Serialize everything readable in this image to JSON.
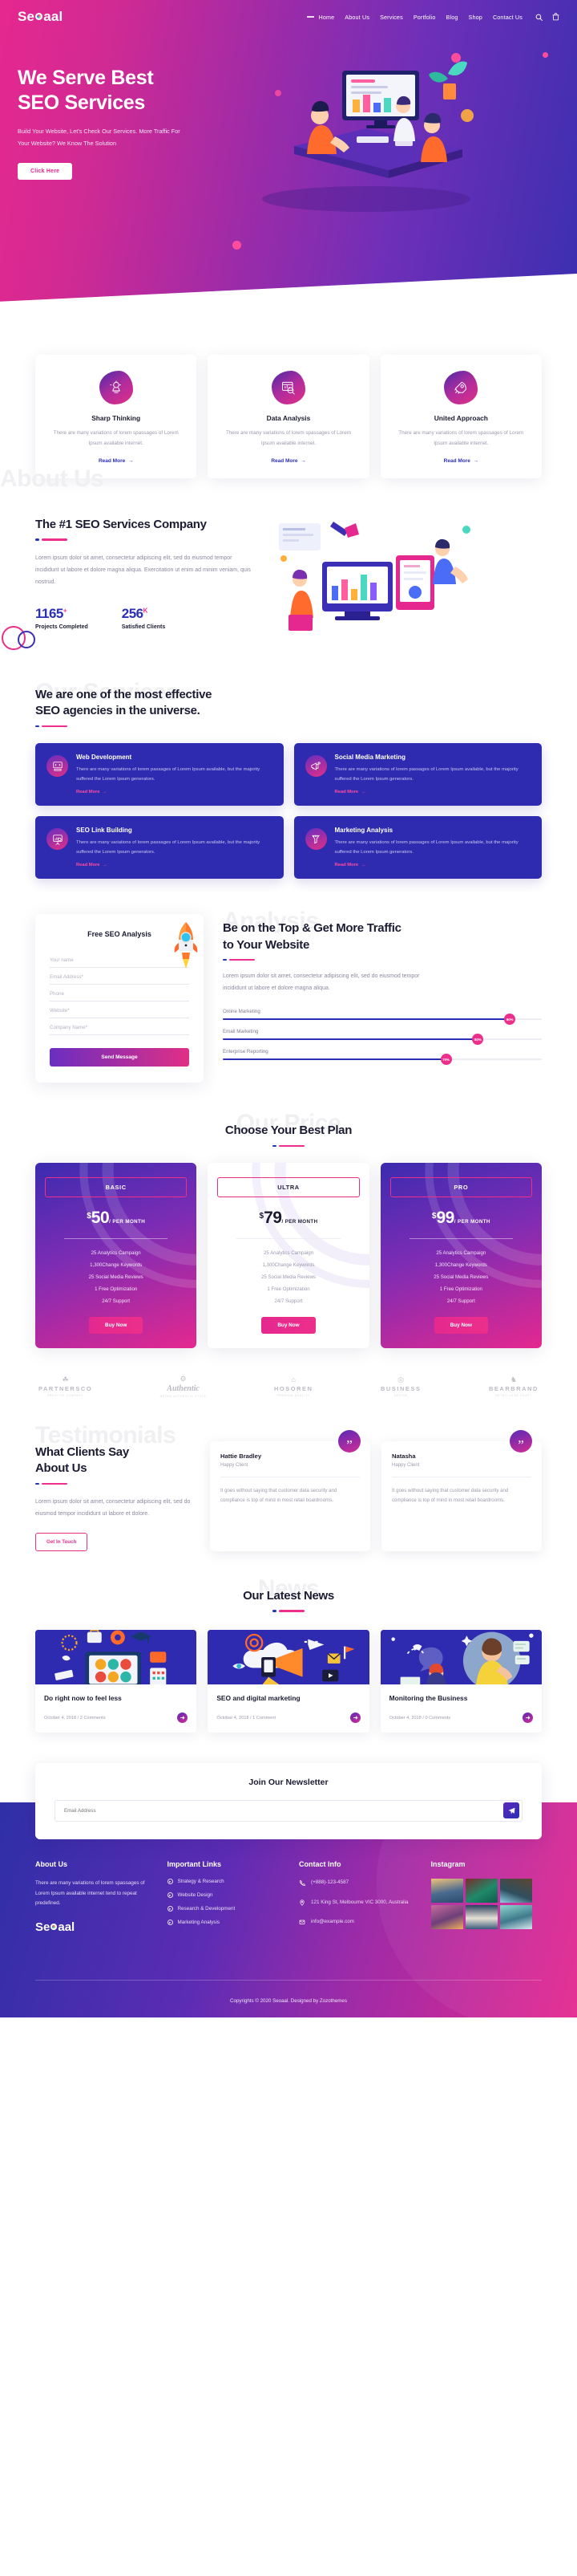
{
  "brand": {
    "name_part1": "Se",
    "name_part2": "aal",
    "logo_dot": "rainbow-dot"
  },
  "colors": {
    "pink": "#ec2f8a",
    "indigo": "#2b2fb5",
    "purple": "#6a2ec0",
    "card_blue": "#2e2bb0"
  },
  "nav": {
    "items": [
      {
        "label": "Home",
        "active": true
      },
      {
        "label": "About Us",
        "active": false
      },
      {
        "label": "Services",
        "active": false
      },
      {
        "label": "Portfolio",
        "active": false
      },
      {
        "label": "Blog",
        "active": false
      },
      {
        "label": "Shop",
        "active": false
      },
      {
        "label": "Contact Us",
        "active": false
      }
    ],
    "icons": [
      "search-icon",
      "cart-icon"
    ]
  },
  "hero": {
    "title_line1": "We Serve Best",
    "title_line2": "SEO Services",
    "subtitle": "Build Your Website, Let's Check Our Services. More Traffic For Your Website? We Know The Solution",
    "button": "Click Here"
  },
  "features": [
    {
      "icon": "sharp-thinking-icon",
      "title": "Sharp Thinking",
      "text": "There are many variations of lorem spassages of Lorem Ipsum available internet.",
      "link": "Read More"
    },
    {
      "icon": "data-analysis-icon",
      "title": "Data Analysis",
      "text": "There are many variations of lorem spassages of Lorem Ipsum available internet.",
      "link": "Read More"
    },
    {
      "icon": "rocket-icon",
      "title": "United Approach",
      "text": "There are many variations of lorem spassages of Lorem Ipsum available internet.",
      "link": "Read More"
    }
  ],
  "about": {
    "watermark": "About Us",
    "title": "The #1 SEO Services Company",
    "text": "Lorem ipsum dolor sit amet, consectetur adipiscing elit, sed do eiusmod tempor incididunt ut labore et dolore magna aliqua. Exercitation ut enim ad minim veniam, quis nostrud.",
    "stats": [
      {
        "value": "1165",
        "suffix": "+",
        "label": "Projects Completed"
      },
      {
        "value": "256",
        "suffix": "K",
        "label": "Satisfied Clients"
      }
    ]
  },
  "services": {
    "watermark": "Our Services",
    "title_line1": "We are one of the most effective",
    "title_line2": "SEO agencies in the universe.",
    "cards": [
      {
        "icon": "code-monitor-icon",
        "title": "Web Development",
        "text": "There are many variations of lorem passages of Lorem Ipsum available, but the majority suffered the Lorem Ipsum generators.",
        "link": "Read More"
      },
      {
        "icon": "megaphone-social-icon",
        "title": "Social Media Marketing",
        "text": "There are many variations of lorem passages of Lorem Ipsum available, but the majority suffered the Lorem Ipsum generators.",
        "link": "Read More"
      },
      {
        "icon": "chart-search-icon",
        "title": "SEO Link Building",
        "text": "There are many variations of lorem passages of Lorem Ipsum available, but the majority suffered the Lorem Ipsum generators.",
        "link": "Read More"
      },
      {
        "icon": "analytics-funnel-icon",
        "title": "Marketing Analysis",
        "text": "There are many variations of lorem passages of Lorem Ipsum available, but the majority suffered the Lorem Ipsum generators.",
        "link": "Read More"
      }
    ]
  },
  "analysis": {
    "watermark": "Analysis",
    "form": {
      "heading": "Free SEO Analysis",
      "fields": [
        {
          "name": "your-name",
          "placeholder": "Your name",
          "value": ""
        },
        {
          "name": "email-address",
          "placeholder": "Email Address*",
          "value": ""
        },
        {
          "name": "phone",
          "placeholder": "Phone",
          "value": ""
        },
        {
          "name": "website",
          "placeholder": "Website*",
          "value": ""
        },
        {
          "name": "company-name",
          "placeholder": "Company Name*",
          "value": ""
        }
      ],
      "submit": "Send Message"
    },
    "title_line1": "Be on the Top & Get More Traffic",
    "title_line2": "to Your Website",
    "text": "Lorem ipsum dolor sit amet, consectetur adipiscing elit, sed do eiusmod tempor incididunt ut labore et dolore magna aliqua.",
    "bars": [
      {
        "label": "Online Marketing",
        "percent": 90,
        "display": "90%"
      },
      {
        "label": "Email Marketing",
        "percent": 80,
        "display": "80%"
      },
      {
        "label": "Enterprise Reporting",
        "percent": 70,
        "display": "70%"
      }
    ]
  },
  "pricing": {
    "watermark": "Our Price",
    "title": "Choose Your Best Plan",
    "plans": [
      {
        "name": "BASIC",
        "currency": "$",
        "amount": "50",
        "period": "/ PER MONTH",
        "featured": true,
        "features": [
          "25 Analytics Campaign",
          "1,300Change Keywords",
          "25 Social Media Reviews",
          "1 Free Optimization",
          "24/7 Support"
        ],
        "button": "Buy Now"
      },
      {
        "name": "ULTRA",
        "currency": "$",
        "amount": "79",
        "period": "/ PER MONTH",
        "featured": false,
        "features": [
          "25 Analytics Campaign",
          "1,300Change Keywords",
          "25 Social Media Reviews",
          "1 Free Optimization",
          "24/7 Support"
        ],
        "button": "Buy Now"
      },
      {
        "name": "PRO",
        "currency": "$",
        "amount": "99",
        "period": "/ PER MONTH",
        "featured": true,
        "features": [
          "25 Analytics Campaign",
          "1,300Change Keywords",
          "25 Social Media Reviews",
          "1 Free Optimization",
          "24/7 Support"
        ],
        "button": "Buy Now"
      }
    ]
  },
  "brands": [
    {
      "glyph": "☘",
      "name": "PARTNERSCO",
      "sub": "CREATIVE COMPANY",
      "script": false
    },
    {
      "glyph": "⚙",
      "name": "Authentic",
      "sub": "RETRO AUTHENTIC STYLE",
      "script": true
    },
    {
      "glyph": "⌂",
      "name": "HOSOREN",
      "sub": "PREMIUM QUALITY",
      "script": false
    },
    {
      "glyph": "◎",
      "name": "BUSINESS",
      "sub": "DESIGN",
      "script": false
    },
    {
      "glyph": "♞",
      "name": "BEARBRAND",
      "sub": "RETRO LOGO CRAFT",
      "script": false
    }
  ],
  "testimonials": {
    "watermark": "Testimonials",
    "title_line1": "What Clients Say",
    "title_line2": "About Us",
    "text": "Lorem ipsum dolor sit amet, consectetur adipiscing elit, sed do eiusmod tempor incididunt ut labore et dolore.",
    "button": "Get In Touch",
    "cards": [
      {
        "name": "Hattie Bradley",
        "role": "Happy Client",
        "quote": "It goes without saying that customer data security and compliance is top of mind in most retail boardrooms."
      },
      {
        "name": "Natasha",
        "role": "Happy Client",
        "quote": "It goes without saying that customer data security and compliance is top of mind in most retail boardrooms."
      }
    ]
  },
  "news": {
    "watermark": "News",
    "title": "Our Latest News",
    "posts": [
      {
        "thumb": "education-desk-illustration",
        "title": "Do right now to feel less",
        "date": "October 4, 2018",
        "comments": "2 Comments"
      },
      {
        "thumb": "digital-marketing-illustration",
        "title": "SEO and digital marketing",
        "date": "October 4, 2018",
        "comments": "1 Comment"
      },
      {
        "thumb": "monitoring-business-illustration",
        "title": "Monitoring the Business",
        "date": "October 4, 2018",
        "comments": "0 Comments"
      }
    ]
  },
  "newsletter": {
    "heading": "Join Our Newsletter",
    "placeholder": "Email Address",
    "value": "",
    "button_icon": "paper-plane-icon"
  },
  "footer": {
    "about": {
      "heading": "About Us",
      "text": "There are many variations of lorem spassages of Lorem Ipsum available internet tend to repeat predefined."
    },
    "links": {
      "heading": "Important Links",
      "items": [
        "Strategy & Research",
        "Website Design",
        "Research & Development",
        "Marketing Analysis"
      ]
    },
    "contact": {
      "heading": "Contact Info",
      "phone": "(+888)-123-4587",
      "address": "121 King St, Melbourne VIC 3000, Australia",
      "email": "info@example.com"
    },
    "instagram": {
      "heading": "Instagram",
      "count": 6
    },
    "copyright": "Copyrights © 2020 Seoaal. Designed by Zozothemes"
  }
}
